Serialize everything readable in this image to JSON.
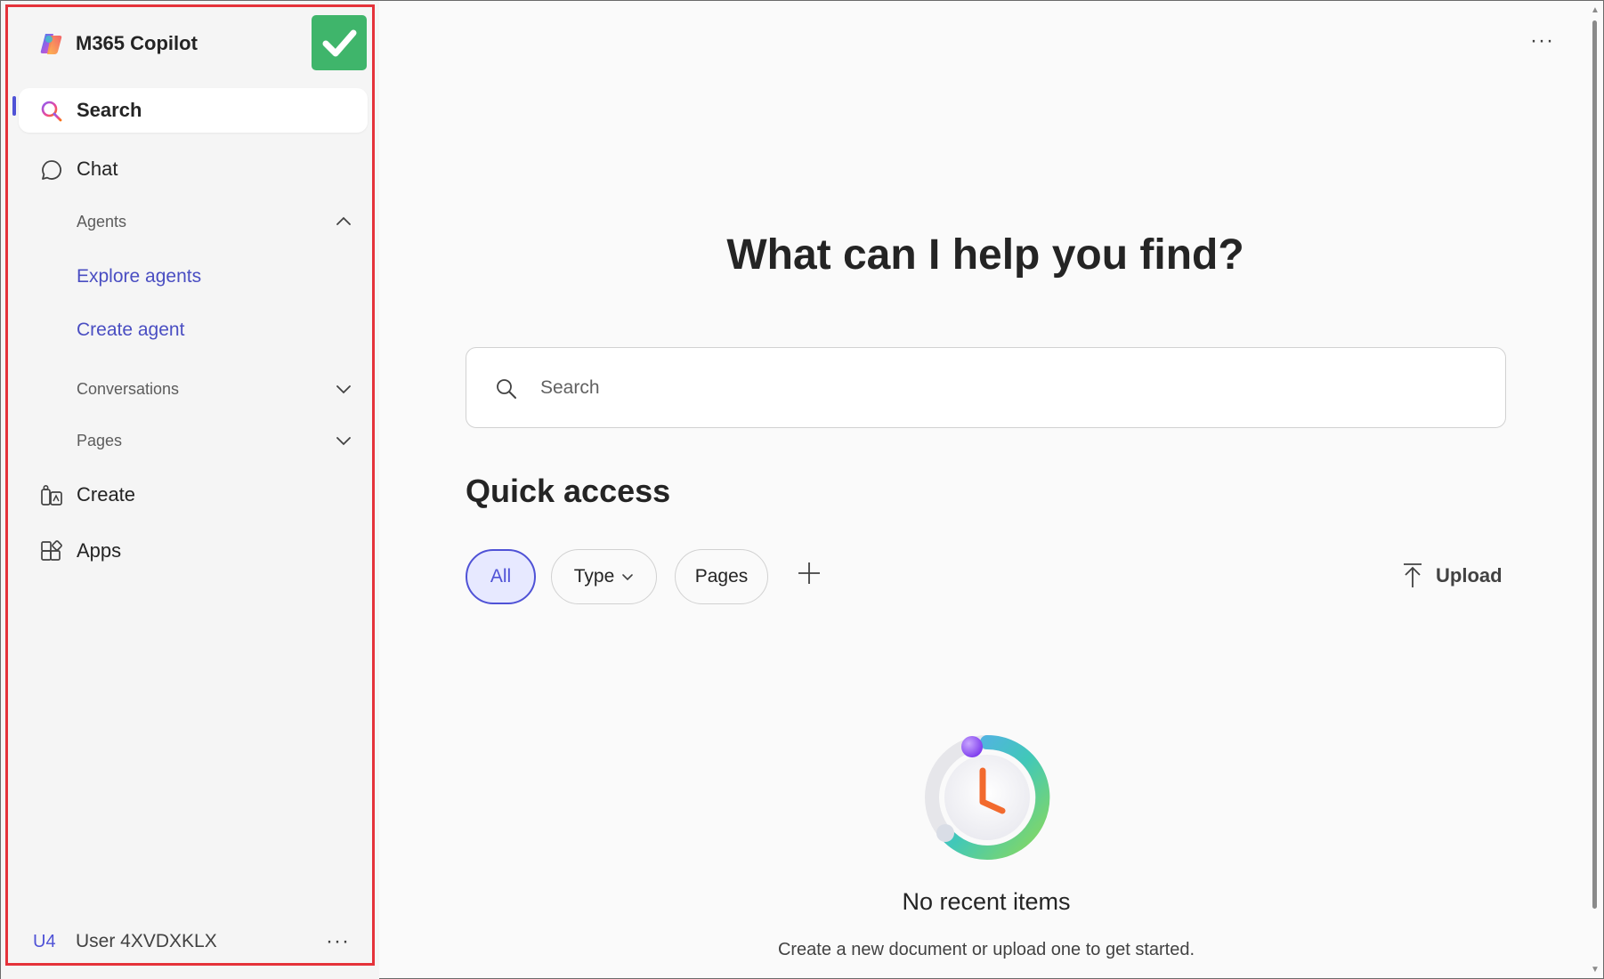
{
  "app": {
    "name": "M365 Copilot"
  },
  "colors": {
    "accent": "#4f52d6",
    "badge": "#3fb56b",
    "outline": "#e5323a"
  },
  "sidebar": {
    "search_label": "Search",
    "chat_label": "Chat",
    "agents_label": "Agents",
    "explore_agents_label": "Explore agents",
    "create_agent_label": "Create agent",
    "conversations_label": "Conversations",
    "pages_label": "Pages",
    "create_label": "Create",
    "apps_label": "Apps"
  },
  "user": {
    "initials": "U4",
    "name": "User 4XVDXKLX",
    "more_label": "···"
  },
  "main": {
    "more_label": "···",
    "hero_title": "What can I help you find?",
    "search_placeholder": "Search",
    "quick_access_title": "Quick access",
    "filters": {
      "all": "All",
      "type": "Type",
      "pages": "Pages"
    },
    "upload_label": "Upload",
    "empty_title": "No recent items",
    "empty_subtitle": "Create a new document or upload one to get started."
  }
}
